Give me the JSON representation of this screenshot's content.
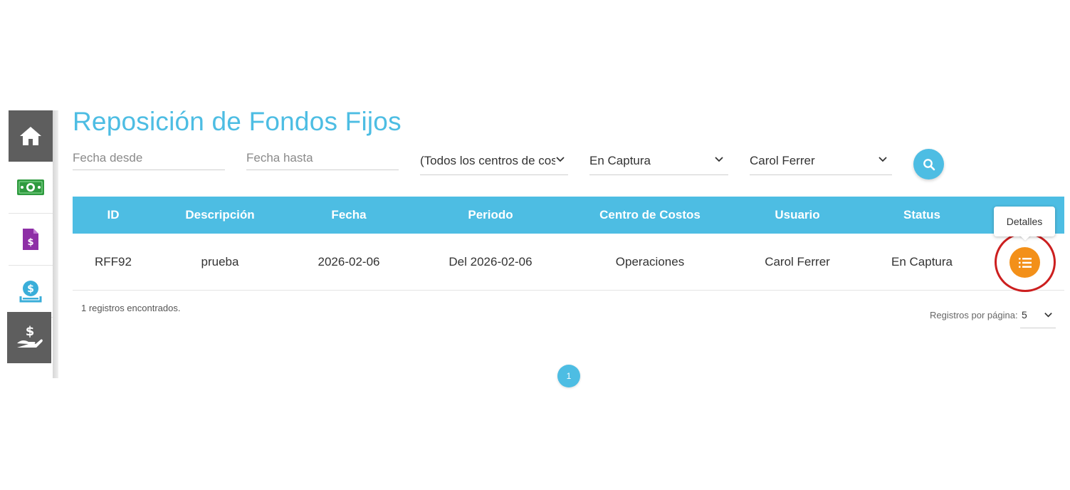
{
  "sidebar": {
    "items": [
      {
        "icon": "home-icon",
        "active": true
      },
      {
        "icon": "money-bill-icon",
        "active": false
      },
      {
        "icon": "invoice-icon",
        "active": false
      },
      {
        "icon": "coin-deposit-icon",
        "active": false
      },
      {
        "icon": "hand-dollar-icon",
        "active": true
      }
    ]
  },
  "page": {
    "title": "Reposición de Fondos Fijos"
  },
  "filters": {
    "date_from_placeholder": "Fecha desde",
    "date_to_placeholder": "Fecha hasta",
    "cost_center_selected": "(Todos los centros de costos)",
    "status_selected": "En Captura",
    "user_selected": "Carol Ferrer"
  },
  "table": {
    "columns": [
      "ID",
      "Descripción",
      "Fecha",
      "Periodo",
      "Centro de Costos",
      "Usuario",
      "Status"
    ],
    "rows": [
      {
        "id": "RFF92",
        "descripcion": "prueba",
        "fecha": "2026-02-06",
        "periodo": "Del 2026-02-06",
        "centro_costos": "Operaciones",
        "usuario": "Carol Ferrer",
        "status": "En Captura"
      }
    ],
    "details_tooltip": "Detalles"
  },
  "footer": {
    "records_found": "1 registros encontrados.",
    "per_page_label": "Registros por página:",
    "per_page_value": "5",
    "current_page": "1"
  },
  "colors": {
    "accent": "#4dbde3",
    "details_button": "#f39019",
    "highlight": "#cc1f1f",
    "sidebar_dark": "#5e5e5e"
  }
}
